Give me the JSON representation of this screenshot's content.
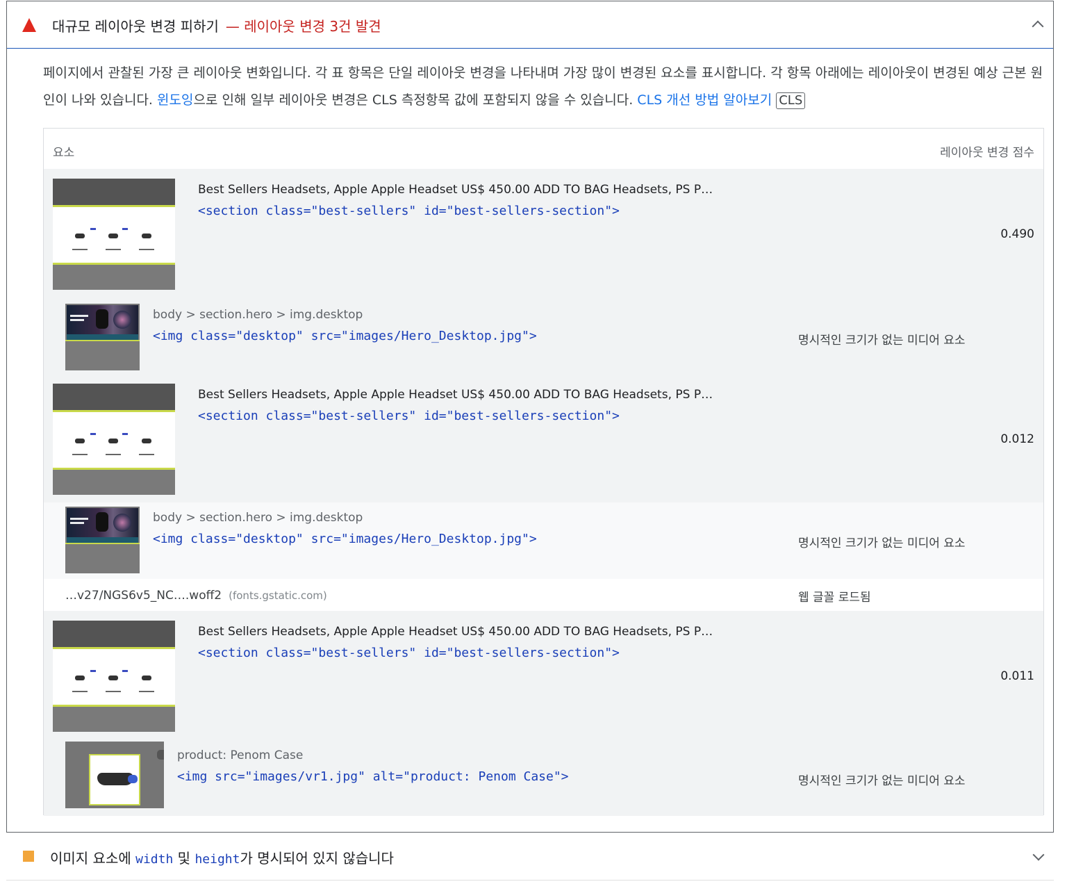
{
  "audit": {
    "title": "대규모 레이아웃 변경 피하기",
    "separator": "—",
    "found": "레이아웃 변경 3건 발견",
    "description_part1": "페이지에서 관찰된 가장 큰 레이아웃 변화입니다. 각 표 항목은 단일 레이아웃 변경을 나타내며 가장 많이 변경된 요소를 표시합니다. 각 항목 아래에는 레이아웃이 변경된 예상 근본 원인이 나와 있습니다. ",
    "windowing_link": "윈도잉",
    "description_part2": "으로 인해 일부 레이아웃 변경은 CLS 측정항목 값에 포함되지 않을 수 있습니다. ",
    "learn_link": "CLS 개선 방법 알아보기",
    "badge": "CLS"
  },
  "table": {
    "col_element": "요소",
    "col_score": "레이아웃 변경 점수",
    "rows": [
      {
        "label": "Best Sellers Headsets, Apple Apple Headset US$ 450.00 ADD TO BAG Headsets, PS P…",
        "code": "<section class=\"best-sellers\" id=\"best-sellers-section\">",
        "score": "0.490",
        "cause_label": "body > section.hero > img.desktop",
        "cause_code": "<img class=\"desktop\" src=\"images/Hero_Desktop.jpg\">",
        "cause_reason": "명시적인 크기가 없는 미디어 요소"
      },
      {
        "label": "Best Sellers Headsets, Apple Apple Headset US$ 450.00 ADD TO BAG Headsets, PS P…",
        "code": "<section class=\"best-sellers\" id=\"best-sellers-section\">",
        "score": "0.012",
        "cause_label": "body > section.hero > img.desktop",
        "cause_code": "<img class=\"desktop\" src=\"images/Hero_Desktop.jpg\">",
        "cause_reason": "명시적인 크기가 없는 미디어 요소",
        "font_url": "…v27/NGS6v5_NC….woff2",
        "font_host": "(fonts.gstatic.com)",
        "font_reason": "웹 글꼴 로드됨"
      },
      {
        "label": "Best Sellers Headsets, Apple Apple Headset US$ 450.00 ADD TO BAG Headsets, PS P…",
        "code": "<section class=\"best-sellers\" id=\"best-sellers-section\">",
        "score": "0.011",
        "cause_label": "product: Penom Case",
        "cause_code": "<img src=\"images/vr1.jpg\" alt=\"product: Penom Case\">",
        "cause_reason": "명시적인 크기가 없는 미디어 요소"
      }
    ]
  },
  "second_audit": {
    "title_prefix": "이미지 요소에 ",
    "code1": "width",
    "middle": " 및 ",
    "code2": "height",
    "title_suffix": "가 명시되어 있지 않습니다"
  },
  "colors": {
    "fail": "#e0291e",
    "warn": "#f2a53a",
    "link": "#1a73e8",
    "code": "#1a3fb8"
  }
}
